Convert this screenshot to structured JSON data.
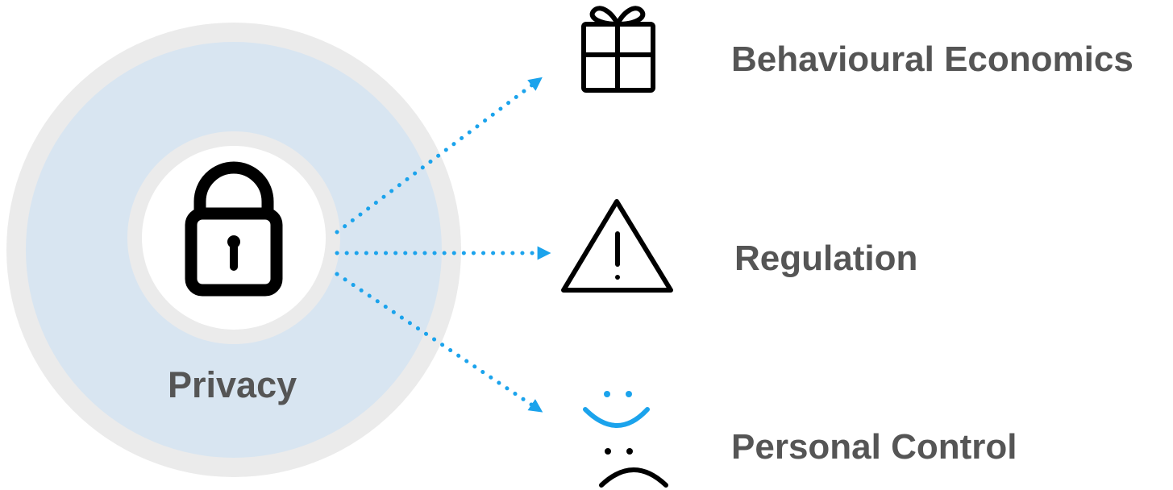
{
  "center": {
    "label": "Privacy",
    "icon": "padlock-icon"
  },
  "branches": [
    {
      "label": "Behavioural Economics",
      "icon": "gift-icon"
    },
    {
      "label": "Regulation",
      "icon": "warning-icon"
    },
    {
      "label": "Personal Control",
      "icon": "happy-sad-faces-icon"
    }
  ],
  "colors": {
    "outer_ring": "#ebebeb",
    "middle_ring": "#d8e5f1",
    "inner_ring": "#ebebeb",
    "core": "#ffffff",
    "arrow": "#1ba3ec",
    "smile": "#1ba3ec",
    "icon_stroke": "#000000",
    "text": "#555555"
  }
}
